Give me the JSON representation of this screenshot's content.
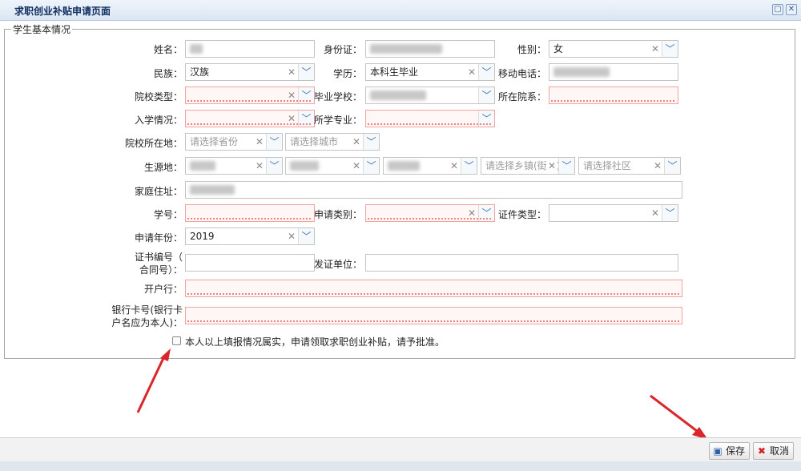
{
  "window": {
    "title": "求职创业补贴申请页面"
  },
  "section": {
    "legend": "学生基本情况"
  },
  "form": {
    "name_label": "姓名：",
    "idcard_label": "身份证：",
    "gender_label": "性别：",
    "gender_value": "女",
    "ethnicity_label": "民族：",
    "ethnicity_value": "汉族",
    "education_label": "学历：",
    "education_value": "本科生毕业",
    "mobile_label": "移动电话：",
    "school_type_label": "院校类型：",
    "grad_school_label": "毕业学校：",
    "department_label": "所在院系：",
    "enrollment_label": "入学情况：",
    "major_label": "所学专业：",
    "school_location_label": "院校所在地：",
    "province_placeholder": "请选择省份",
    "city_placeholder": "请选择城市",
    "origin_label": "生源地：",
    "town_placeholder": "请选择乡镇(街道)",
    "community_placeholder": "请选择社区",
    "address_label": "家庭住址：",
    "student_no_label": "学号：",
    "apply_type_label": "申请类别：",
    "cert_type_label": "证件类型：",
    "apply_year_label": "申请年份：",
    "apply_year_value": "2019",
    "cert_no_label_1": "证书编号（",
    "cert_no_label_2": "合同号）：",
    "issuer_label": "发证单位：",
    "bank_label": "开户行：",
    "bank_card_label_1": "银行卡号(银行卡",
    "bank_card_label_2": "户名应为本人)：",
    "declaration": "本人以上填报情况属实，申请领取求职创业补贴，请予批准。"
  },
  "buttons": {
    "save_label": "保存",
    "cancel_label": "取消"
  },
  "icons": {
    "clear": "✕",
    "dropdown": "﹀",
    "save": "floppy-icon",
    "cancel": "cross-icon"
  },
  "colors": {
    "required_border": "#f0a3a3",
    "arrow": "#d9262b",
    "accent": "#3d6fb3"
  }
}
